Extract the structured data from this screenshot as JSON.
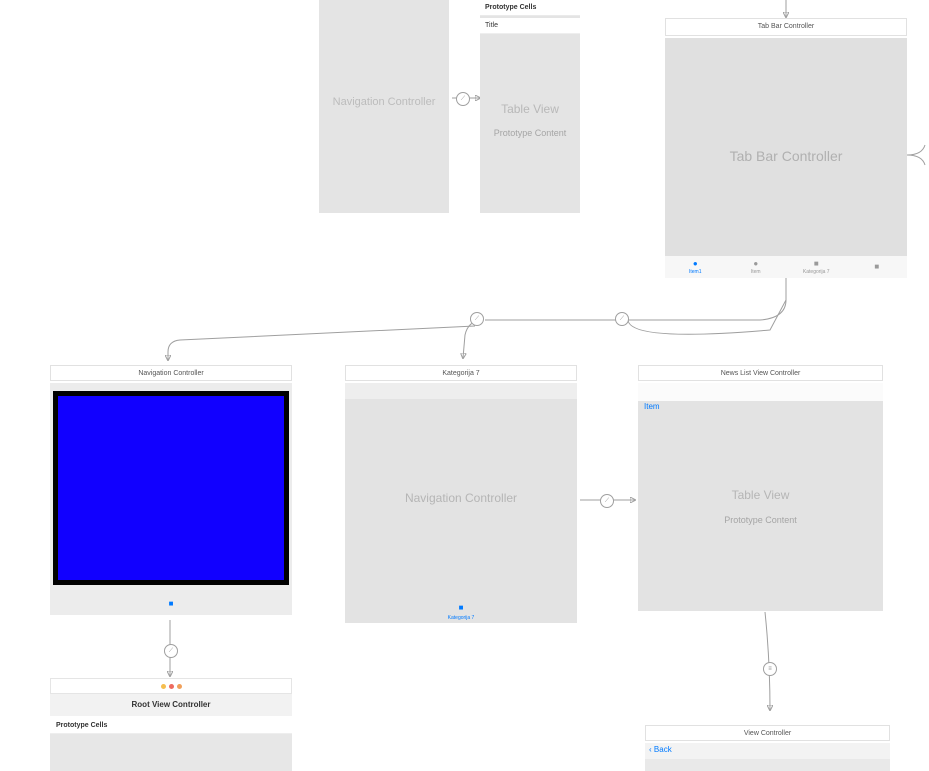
{
  "scenes": {
    "nav1": {
      "label": "Navigation Controller"
    },
    "table1": {
      "prototype_header": "Prototype Cells",
      "row_label": "Title",
      "main_label": "Table View",
      "sub_label": "Prototype Content"
    },
    "tabbar": {
      "title": "Tab Bar Controller",
      "main_label": "Tab Bar Controller",
      "items": [
        {
          "label": "Item1",
          "glyph": "●",
          "active": true
        },
        {
          "label": "Item",
          "glyph": "●",
          "active": false
        },
        {
          "label": "Kategorija 7",
          "glyph": "■",
          "active": false
        },
        {
          "label": "",
          "glyph": "■",
          "active": false
        }
      ]
    },
    "nav2": {
      "title": "Navigation Controller",
      "tab_glyph": "■"
    },
    "root": {
      "header": "Root View Controller",
      "prototype_header": "Prototype Cells"
    },
    "nav3": {
      "title": "Kategorija 7",
      "main_label": "Navigation Controller",
      "tab_glyph": "■",
      "tab_label": "Kategorija 7"
    },
    "news": {
      "title": "News List View Controller",
      "item_label": "Item",
      "main_label": "Table View",
      "sub_label": "Prototype Content"
    },
    "vc": {
      "title": "View Controller",
      "back_label": "Back"
    }
  },
  "icons": {
    "segue": "⟋",
    "embed": "≡",
    "back_chevron": "‹"
  }
}
